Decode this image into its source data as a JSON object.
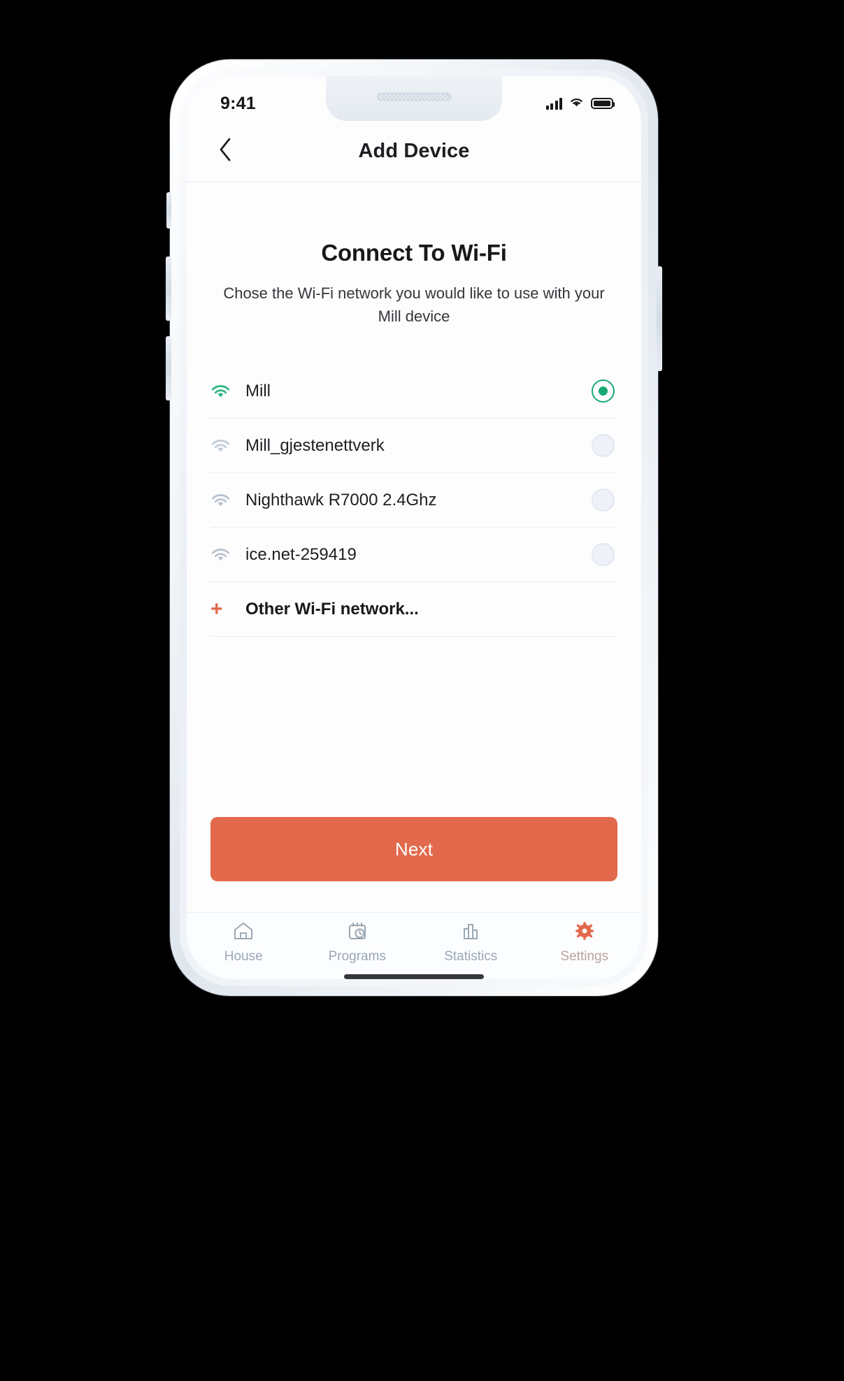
{
  "status_bar": {
    "time": "9:41",
    "signal_icon": "cellular-signal-icon",
    "wifi_icon": "wifi-icon",
    "battery_icon": "battery-full-icon"
  },
  "header": {
    "back_icon": "chevron-left-icon",
    "title": "Add Device"
  },
  "main": {
    "headline": "Connect To Wi-Fi",
    "subtitle": "Chose the Wi-Fi network you would like to use with your Mill device",
    "networks": [
      {
        "ssid": "Mill",
        "icon": "wifi-icon",
        "selected": true,
        "signal": "strong"
      },
      {
        "ssid": "Mill_gjestenettverk",
        "icon": "wifi-icon",
        "selected": false,
        "signal": "weak"
      },
      {
        "ssid": "Nighthawk R7000 2.4Ghz",
        "icon": "wifi-icon",
        "selected": false,
        "signal": "medium"
      },
      {
        "ssid": "ice.net-259419",
        "icon": "wifi-icon",
        "selected": false,
        "signal": "medium"
      }
    ],
    "other_network": {
      "plus_icon": "plus-icon",
      "label": "Other Wi-Fi network..."
    },
    "next_button_label": "Next"
  },
  "tab_bar": {
    "items": [
      {
        "label": "House",
        "icon": "house-icon",
        "active": false
      },
      {
        "label": "Programs",
        "icon": "calendar-clock-icon",
        "active": false
      },
      {
        "label": "Statistics",
        "icon": "bar-chart-icon",
        "active": false
      },
      {
        "label": "Settings",
        "icon": "gear-icon",
        "active": true
      }
    ]
  },
  "colors": {
    "accent_orange": "#e2694c",
    "selected_green": "#19a974",
    "text_primary": "#17181a",
    "text_muted": "#9aa7b4",
    "divider": "#e9edf3"
  }
}
